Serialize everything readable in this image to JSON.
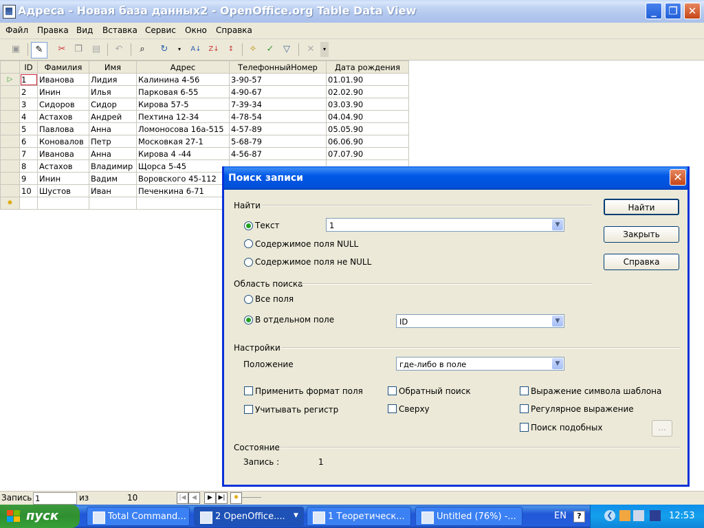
{
  "window": {
    "title": "Адреса - Новая база данных2 - OpenOffice.org Table Data View"
  },
  "menu": [
    "Файл",
    "Правка",
    "Вид",
    "Вставка",
    "Сервис",
    "Окно",
    "Справка"
  ],
  "grid": {
    "columns": [
      "ID",
      "Фамилия",
      "Имя",
      "Адрес",
      "ТелефонныйНомер",
      "Дата рождения"
    ],
    "rows": [
      [
        "1",
        "Иванова",
        "Лидия",
        "Калинина 4-56",
        "3-90-57",
        "01.01.90"
      ],
      [
        "2",
        "Инин",
        "Илья",
        "Парковая 6-55",
        "4-90-67",
        "02.02.90"
      ],
      [
        "3",
        "Сидоров",
        "Сидор",
        "Кирова 57-5",
        "7-39-34",
        "03.03.90"
      ],
      [
        "4",
        "Астахов",
        "Андрей",
        "Пехтина 12-34",
        "4-78-54",
        "04.04.90"
      ],
      [
        "5",
        "Павлова",
        "Анна",
        "Ломоносова 16а-515",
        "4-57-89",
        "05.05.90"
      ],
      [
        "6",
        "Коновалов",
        "Петр",
        "Московкая 27-1",
        "5-68-79",
        "06.06.90"
      ],
      [
        "7",
        "Иванова",
        "Анна",
        "Кирова 4 -44",
        "4-56-87",
        "07.07.90"
      ],
      [
        "8",
        "Астахов",
        "Владимир",
        "Щорса 5-45",
        "",
        ""
      ],
      [
        "9",
        "Инин",
        "Вадим",
        "Воровского 45-112",
        "",
        ""
      ],
      [
        "10",
        "Шустов",
        "Иван",
        "Печенкина 6-71",
        "",
        ""
      ]
    ]
  },
  "navbar": {
    "record_label": "Запись",
    "record_value": "1",
    "of_label": "из",
    "total": "10"
  },
  "dialog": {
    "title": "Поиск записи",
    "find_section": "Найти",
    "radio_text": "Текст",
    "text_value": "1",
    "radio_null": "Содержимое поля NULL",
    "radio_not_null": "Содержимое поля не NULL",
    "area_section": "Область поиска",
    "radio_all_fields": "Все поля",
    "radio_single_field": "В отдельном поле",
    "field_value": "ID",
    "settings_section": "Настройки",
    "position_label": "Положение",
    "position_value": "где-либо в поле",
    "chk_apply_format": "Применить формат поля",
    "chk_match_case": "Учитывать регистр",
    "chk_backwards": "Обратный поиск",
    "chk_from_top": "Сверху",
    "chk_wildcard": "Выражение символа шаблона",
    "chk_regex": "Регулярное выражение",
    "chk_similar": "Поиск подобных",
    "similar_btn": "...",
    "state_section": "Состояние",
    "record_label": "Запись :",
    "record_value": "1",
    "btn_find": "Найти",
    "btn_close": "Закрыть",
    "btn_help": "Справка"
  },
  "taskbar": {
    "start": "пуск",
    "tasks": [
      "Total Command...",
      "2 OpenOffice....",
      "1 Теоретическ...",
      "Untitled (76%) -..."
    ],
    "lang": "EN",
    "clock": "12:53"
  }
}
